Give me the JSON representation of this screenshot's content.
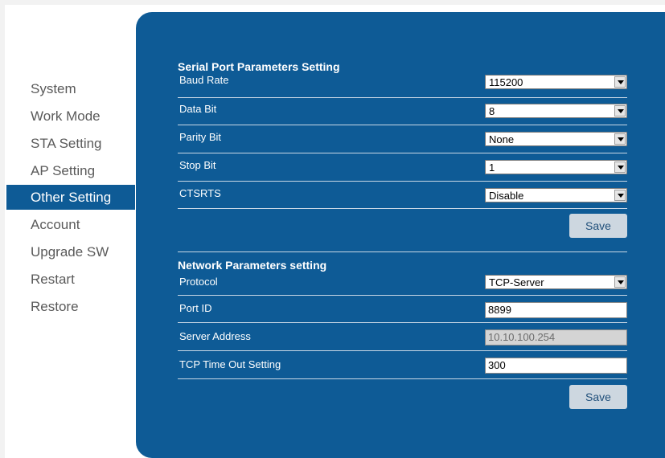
{
  "nav": {
    "items": [
      {
        "label": "System"
      },
      {
        "label": "Work Mode"
      },
      {
        "label": "STA Setting"
      },
      {
        "label": "AP Setting"
      },
      {
        "label": "Other Setting"
      },
      {
        "label": "Account"
      },
      {
        "label": "Upgrade SW"
      },
      {
        "label": "Restart"
      },
      {
        "label": "Restore"
      }
    ],
    "active_index": 4
  },
  "serial": {
    "title": "Serial Port Parameters Setting",
    "baud_rate": {
      "label": "Baud Rate",
      "value": "115200"
    },
    "data_bit": {
      "label": "Data Bit",
      "value": "8"
    },
    "parity_bit": {
      "label": "Parity Bit",
      "value": "None"
    },
    "stop_bit": {
      "label": "Stop Bit",
      "value": "1"
    },
    "ctsrts": {
      "label": "CTSRTS",
      "value": "Disable"
    },
    "save_label": "Save"
  },
  "network": {
    "title": "Network Parameters setting",
    "protocol": {
      "label": "Protocol",
      "value": "TCP-Server"
    },
    "port_id": {
      "label": "Port ID",
      "value": "8899"
    },
    "server_address": {
      "label": "Server Address",
      "value": "10.10.100.254"
    },
    "tcp_timeout": {
      "label": "TCP Time Out Setting",
      "value": "300"
    },
    "save_label": "Save"
  },
  "colors": {
    "panel": "#0e5b96",
    "active_nav": "#0e5b96",
    "button": "#cdd7e0"
  }
}
